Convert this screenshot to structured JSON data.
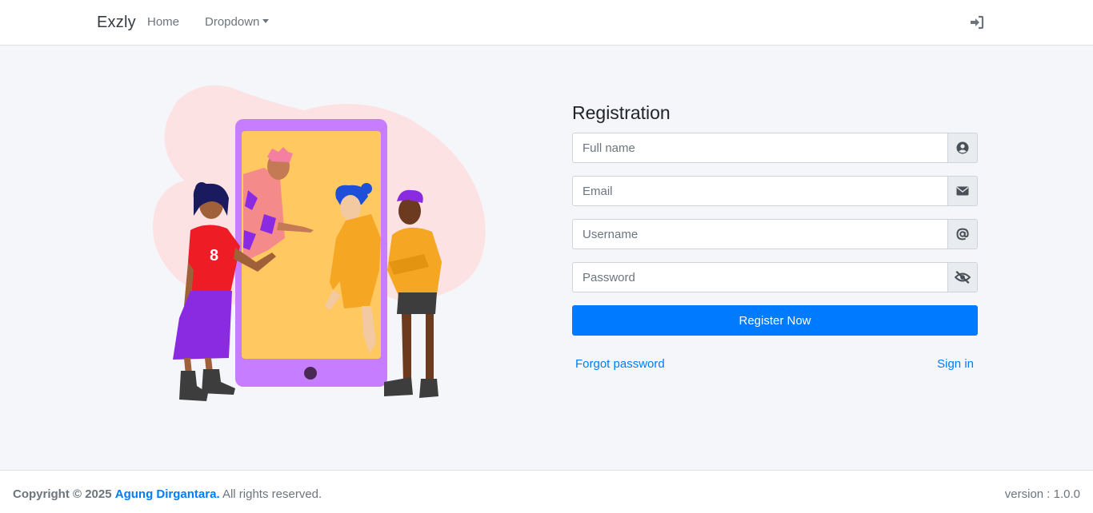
{
  "navbar": {
    "brand": "Exzly",
    "home_label": "Home",
    "dropdown_label": "Dropdown",
    "signin_icon": "sign-in-icon"
  },
  "form": {
    "title": "Registration",
    "fields": [
      {
        "placeholder": "Full name",
        "value": "",
        "icon": "user-circle-icon"
      },
      {
        "placeholder": "Email",
        "value": "",
        "icon": "envelope-icon"
      },
      {
        "placeholder": "Username",
        "value": "",
        "icon": "at-icon"
      },
      {
        "placeholder": "Password",
        "value": "",
        "icon": "eye-slash-icon"
      }
    ],
    "submit_label": "Register Now",
    "forgot_label": "Forgot password",
    "signin_label": "Sign in"
  },
  "footer": {
    "copyright_prefix": "Copyright © 2025",
    "author": "Agung Dirgantara.",
    "rights": "All rights reserved.",
    "version": "version : 1.0.0"
  },
  "colors": {
    "accent": "#007bff",
    "background": "#f4f6f9",
    "blob": "#fde2e4",
    "phone": "#c77dff",
    "screen": "#ffc861"
  }
}
